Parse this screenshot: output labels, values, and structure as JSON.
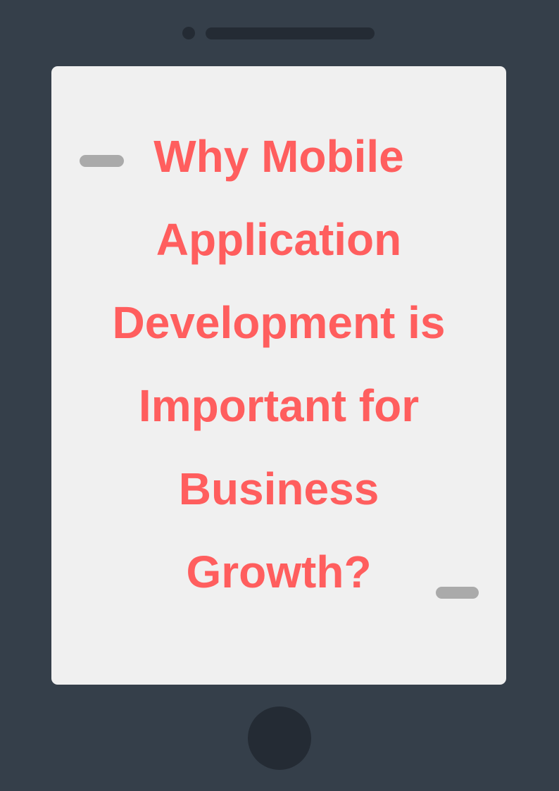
{
  "title_lines": [
    "Why Mobile",
    "Application",
    "Development is",
    "Important for",
    "Business",
    "Growth?"
  ],
  "colors": {
    "frame": "#353f4a",
    "screen": "#f0f0f0",
    "title": "#ff5e5e",
    "accent_pill": "#aaaaaa",
    "dark": "#242b34"
  }
}
